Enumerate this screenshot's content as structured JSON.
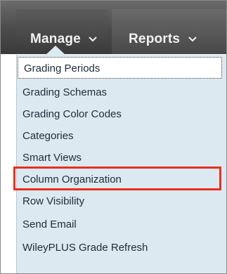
{
  "tabs": {
    "manage_label": "Manage",
    "reports_label": "Reports"
  },
  "menu": {
    "items": [
      "Grading Periods",
      "Grading Schemas",
      "Grading Color Codes",
      "Categories",
      "Smart Views",
      "Column Organization",
      "Row Visibility",
      "Send Email",
      "WileyPLUS Grade Refresh"
    ]
  },
  "colors": {
    "highlight": "#e8301f",
    "menu_bg": "#dde9f0",
    "topbar": "#4a4a4a"
  }
}
